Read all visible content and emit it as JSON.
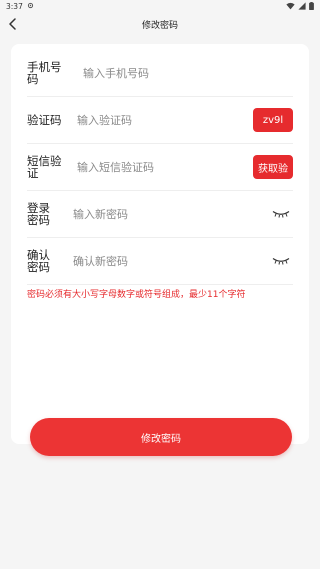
{
  "status_bar": {
    "time": "3:37"
  },
  "nav": {
    "title": "修改密码"
  },
  "form": {
    "phone": {
      "label": "手机号码",
      "placeholder": "输入手机号码"
    },
    "captcha": {
      "label": "验证码",
      "placeholder": "输入验证码",
      "code": "zv9l"
    },
    "sms": {
      "label": "短信验证",
      "placeholder": "输入短信验证码",
      "button": "获取验"
    },
    "password": {
      "label": "登录密码",
      "placeholder": "输入新密码"
    },
    "confirm": {
      "label": "确认密码",
      "placeholder": "确认新密码"
    }
  },
  "hint": "密码必须有大小写字母数字或符号组成，最少11个字符",
  "submit_label": "修改密码",
  "colors": {
    "accent": "#e62b2e",
    "background": "#f5f5f5",
    "card": "#ffffff"
  },
  "icons": [
    "back-icon",
    "eye-closed-icon",
    "wifi-icon",
    "battery-icon"
  ]
}
